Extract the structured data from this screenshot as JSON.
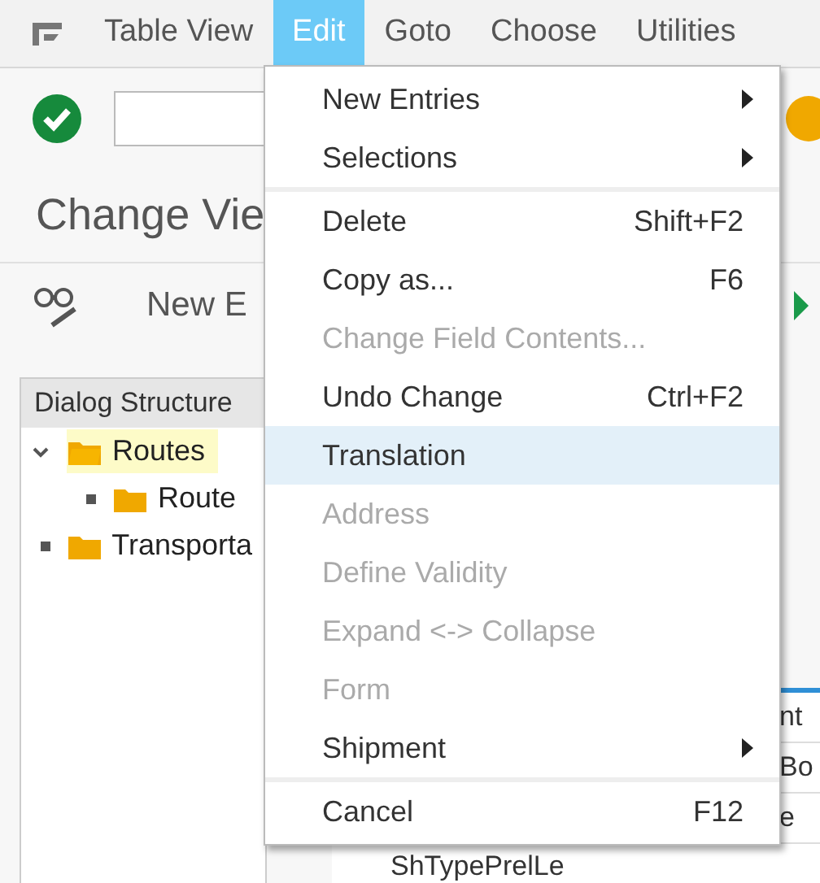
{
  "menubar": {
    "items": [
      {
        "label": "Table View",
        "selected": false
      },
      {
        "label": "Edit",
        "selected": true
      },
      {
        "label": "Goto",
        "selected": false
      },
      {
        "label": "Choose",
        "selected": false
      },
      {
        "label": "Utilities",
        "selected": false
      }
    ]
  },
  "title": "Change Vie",
  "toolbar": {
    "button": "New E"
  },
  "dialog_structure": {
    "header": "Dialog Structure",
    "tree": [
      {
        "label": "Routes",
        "expanded": true,
        "selected": true,
        "children": [
          {
            "label": "Route",
            "selected": false
          }
        ]
      },
      {
        "label": "Transporta",
        "selected": false
      }
    ]
  },
  "table": {
    "rows": [
      "nt",
      "Bo",
      "e",
      "ShTypePrelLe"
    ]
  },
  "menu": {
    "groups": [
      [
        {
          "label": "New Entries",
          "submenu": true,
          "disabled": false,
          "selected": false
        },
        {
          "label": "Selections",
          "submenu": true,
          "disabled": false,
          "selected": false
        }
      ],
      [
        {
          "label": "Delete",
          "shortcut": "Shift+F2",
          "disabled": false,
          "selected": false
        },
        {
          "label": "Copy as...",
          "shortcut": "F6",
          "disabled": false,
          "selected": false
        },
        {
          "label": "Change Field Contents...",
          "disabled": true,
          "selected": false
        },
        {
          "label": "Undo Change",
          "shortcut": "Ctrl+F2",
          "disabled": false,
          "selected": false
        },
        {
          "label": "Translation",
          "disabled": false,
          "selected": true
        },
        {
          "label": "Address",
          "disabled": true,
          "selected": false
        },
        {
          "label": "Define Validity",
          "disabled": true,
          "selected": false
        },
        {
          "label": "Expand <-> Collapse",
          "disabled": true,
          "selected": false
        },
        {
          "label": "Form",
          "disabled": true,
          "selected": false
        },
        {
          "label": "Shipment",
          "submenu": true,
          "disabled": false,
          "selected": false
        }
      ],
      [
        {
          "label": "Cancel",
          "shortcut": "F12",
          "disabled": false,
          "selected": false
        }
      ]
    ]
  }
}
